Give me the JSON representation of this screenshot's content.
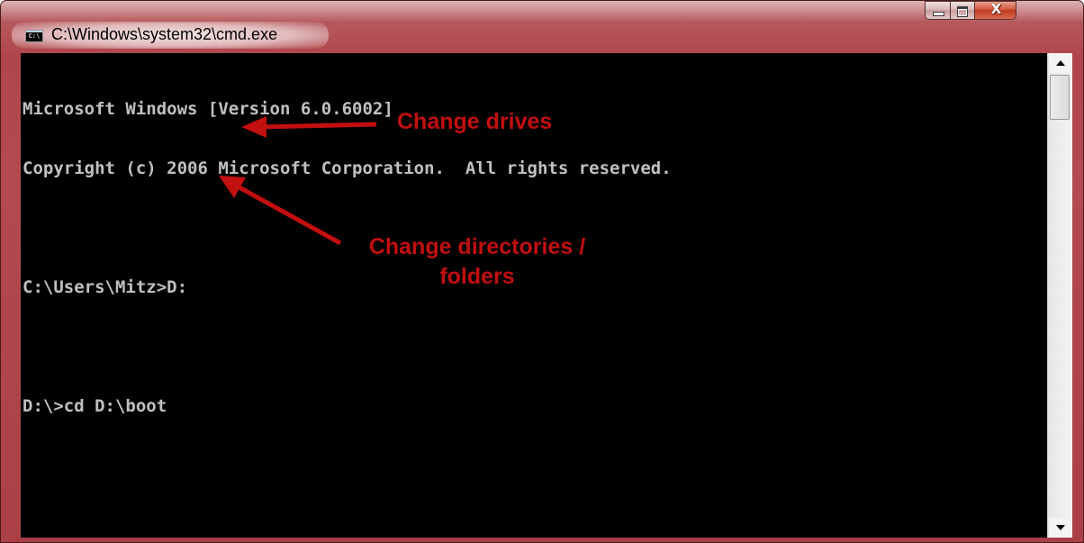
{
  "window": {
    "title": "C:\\Windows\\system32\\cmd.exe",
    "icon": "cmd-console-icon",
    "icon_glyph": "C:\\",
    "controls": {
      "minimize_icon": "minimize-icon",
      "maximize_icon": "maximize-icon",
      "close_icon": "close-icon",
      "close_glyph": "X"
    }
  },
  "console": {
    "lines": [
      "Microsoft Windows [Version 6.0.6002]",
      "Copyright (c) 2006 Microsoft Corporation.  All rights reserved.",
      "",
      "C:\\Users\\Mitz>D:",
      "",
      "D:\\>cd D:\\boot"
    ]
  },
  "annotations": {
    "change_drives": "Change drives",
    "change_dirs_line1": "Change directories /",
    "change_dirs_line2": "folders",
    "color": "#c20f0f"
  },
  "colors": {
    "frame": "#b0464c",
    "console_bg": "#000000",
    "console_text": "#c0c0c0",
    "close_button": "#c03a22"
  }
}
